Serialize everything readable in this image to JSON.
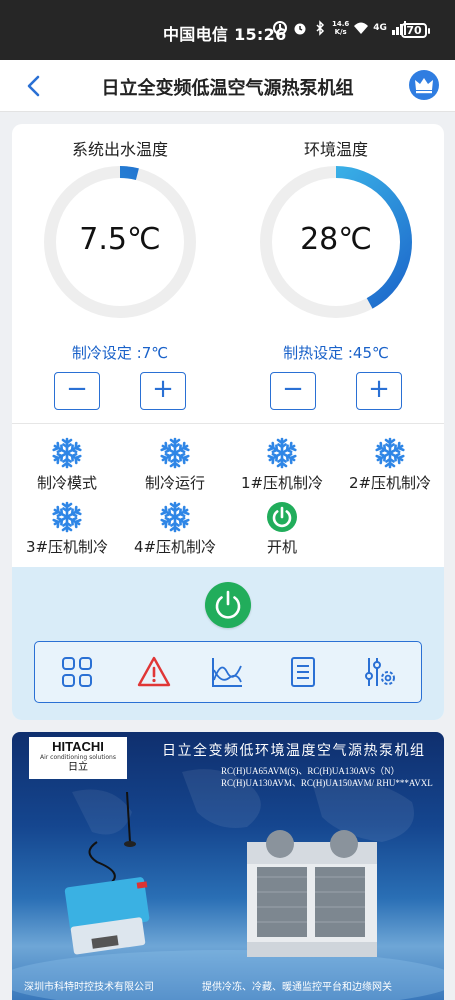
{
  "status_bar": {
    "carrier_time": "中国电信 15:26",
    "network_speed_value": "14.6",
    "network_speed_unit": "K/s",
    "network_type": "4G",
    "battery": "70"
  },
  "header": {
    "title": "日立全变频低温空气源热泵机组",
    "back_icon": "chevron-left-icon",
    "crown_icon": "crown-icon"
  },
  "gauges": [
    {
      "label": "系统出水温度",
      "value": "7.5℃",
      "progress": 0.04,
      "setpoint": "制冷设定 :7℃"
    },
    {
      "label": "环境温度",
      "value": "28℃",
      "progress": 0.42,
      "setpoint": "制热设定 :45℃"
    }
  ],
  "stepper": {
    "minus": "−",
    "plus": "+"
  },
  "status_items": [
    {
      "label": "制冷模式",
      "icon": "snowflake-icon"
    },
    {
      "label": "制冷运行",
      "icon": "snowflake-icon"
    },
    {
      "label": "1#压机制冷",
      "icon": "snowflake-icon"
    },
    {
      "label": "2#压机制冷",
      "icon": "snowflake-icon"
    },
    {
      "label": "3#压机制冷",
      "icon": "snowflake-icon"
    },
    {
      "label": "4#压机制冷",
      "icon": "snowflake-icon"
    },
    {
      "label": "开机",
      "icon": "power-icon"
    }
  ],
  "toolbar": [
    "grid-icon",
    "alarm-icon",
    "chart-icon",
    "list-icon",
    "settings-sliders-icon"
  ],
  "banner": {
    "brand": "HITACHI",
    "brand_sub": "Air conditioning solutions",
    "brand_cn": "日立",
    "title": "日立全变频低环境温度空气源热泵机组",
    "models_line1": "RC(H)UA65AVM(S)、RC(H)UA130AVS（N）",
    "models_line2": "RC(H)UA130AVM、RC(H)UA150AVM/ RHU***AVXL",
    "footer_left": "深圳市科特时控技术有限公司",
    "footer_right": "提供冷冻、冷藏、暖通监控平台和边缘网关"
  },
  "colors": {
    "accent": "#2a70d4",
    "gauge_track": "#eeeeee",
    "gauge_fill_start": "#1b63c9",
    "gauge_fill_end": "#43c8f0",
    "snowflake": "#2f86e6",
    "power_green": "#21ad5b",
    "alarm_red": "#e03636",
    "panel_bg": "#d9ecf8"
  }
}
